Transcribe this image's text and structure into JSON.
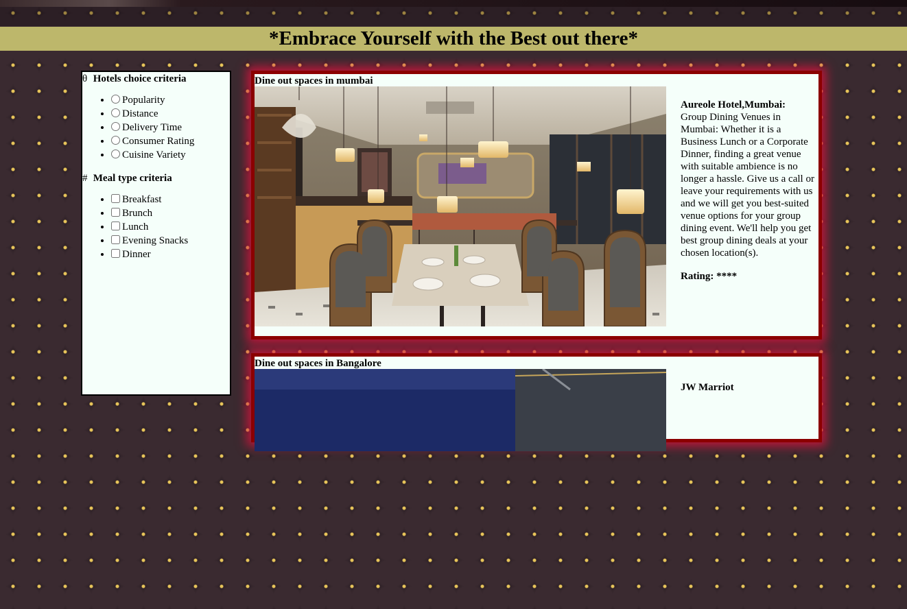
{
  "banner": {
    "title": "*Embrace Yourself with the Best out there*"
  },
  "sidebar": {
    "hotel_criteria": {
      "icon": "theta-icon",
      "icon_glyph": "θ",
      "heading": "Hotels choice criteria",
      "options": [
        "Popularity",
        "Distance",
        "Delivery Time",
        "Consumer Rating",
        "Cuisine Variety"
      ]
    },
    "meal_criteria": {
      "icon": "hash-icon",
      "icon_glyph": "#",
      "heading": "Meal type criteria",
      "options": [
        "Breakfast",
        "Brunch",
        "Lunch",
        "Evening Snacks",
        "Dinner"
      ]
    }
  },
  "cards": [
    {
      "title": "Dine out spaces in mumbai",
      "hotel_name": "Aureole Hotel,Mumbai:",
      "description": "Group Dining Venues in Mumbai: Whether it is a Business Lunch or a Corporate Dinner, finding a great venue with suitable ambience is no longer a hassle. Give us a call or leave your requirements with us and we will get you best-suited venue options for your group dining event. We'll help you get best group dining deals at your chosen location(s).",
      "rating_label": "Rating:",
      "rating_value": "****"
    },
    {
      "title": "Dine out spaces in Bangalore",
      "hotel_name": "JW Marriot"
    }
  ],
  "colors": {
    "banner": "#bdb76b",
    "panel_bg": "#f5fffa",
    "card_border": "#8b0000",
    "card_glow": "#d2143c"
  }
}
